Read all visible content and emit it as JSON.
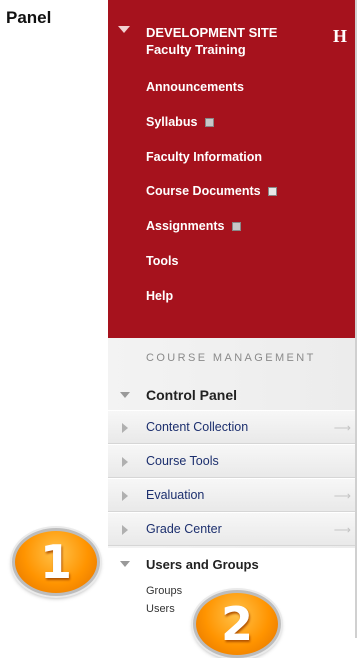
{
  "panel_label": "Panel",
  "partial_letter": "H",
  "course_menu": {
    "site_title_line1": "DEVELOPMENT SITE",
    "site_title_line2": "Faculty Training",
    "items": [
      {
        "label": "Announcements"
      },
      {
        "label": "Syllabus",
        "badge": "content-badge-icon"
      },
      {
        "label": "Faculty Information"
      },
      {
        "label": "Course Documents",
        "badge": "edit-badge-icon"
      },
      {
        "label": "Assignments",
        "badge": "content-badge-icon"
      },
      {
        "label": "Tools"
      },
      {
        "label": "Help"
      }
    ],
    "bg_color": "#a6121d"
  },
  "course_management": {
    "title": "COURSE MANAGEMENT",
    "control_panel": "Control Panel",
    "sections": [
      {
        "label": "Content Collection",
        "has_arrow": true
      },
      {
        "label": "Course Tools",
        "has_arrow": false
      },
      {
        "label": "Evaluation",
        "has_arrow": true
      },
      {
        "label": "Grade Center",
        "has_arrow": true
      }
    ],
    "users_and_groups": {
      "label": "Users and Groups",
      "links": [
        "Groups",
        "Users"
      ]
    }
  },
  "callouts": [
    "1",
    "2"
  ],
  "callout_color": "#ff9400"
}
